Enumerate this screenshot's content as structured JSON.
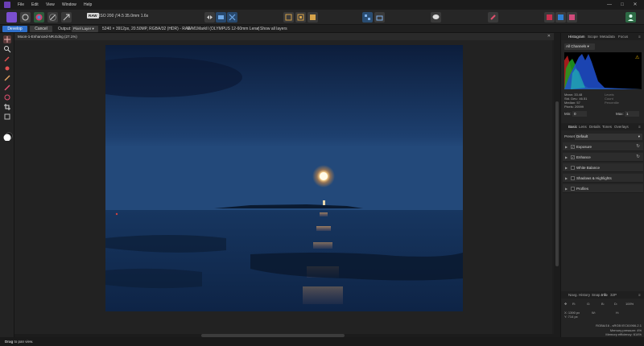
{
  "menu": {
    "items": [
      "File",
      "Edit",
      "View",
      "Window",
      "Help"
    ],
    "window_controls": [
      "—",
      "□",
      "✕"
    ]
  },
  "toolbar": {
    "raw_badge": "RAW",
    "exif": "ISO 200 ƒ/4.5 35.0mm 1.6s"
  },
  "context": {
    "develop_label": "Develop",
    "cancel_label": "Cancel",
    "output_label": "Output:",
    "output_value": "Pixel Layer",
    "image_info": "5240 × 3912px, 20.50MP, RGBA/32 (HDR) - RAW",
    "camera_info": "E-M1MarkII (OLYMPUS 12-60mm Lens)",
    "show_all_layers": "Show all layers"
  },
  "document": {
    "tab_title": "Moon-1-Enhanced-NR.Edng (27.1%)"
  },
  "histogram": {
    "tabs": [
      "Histogram",
      "Scope",
      "Metadata",
      "Focus"
    ],
    "channel": "All Channels",
    "mean": "Mean: 33.48",
    "std_dev": "Std. Dev.: 46.51",
    "median": "Median: 57",
    "pixels": "Pixels: 20599",
    "levels": "Levels",
    "count": "Count",
    "percentile": "Percentile",
    "min_label": "Min:",
    "min_value": "0",
    "max_label": "Max:",
    "max_value": "1",
    "warning_icon": "warning-triangle-icon"
  },
  "adjust": {
    "tabs": [
      "Basic",
      "Lens",
      "Details",
      "Tones",
      "Overlays"
    ],
    "preset_label": "Preset:",
    "preset_value": "Default",
    "sections": [
      {
        "name": "Exposure",
        "checked": true
      },
      {
        "name": "Enhance",
        "checked": true
      },
      {
        "name": "White Balance",
        "checked": false
      },
      {
        "name": "Shadows & Highlights",
        "checked": false
      },
      {
        "name": "Profiles",
        "checked": false
      }
    ]
  },
  "info": {
    "tabs": [
      "Navg.",
      "History",
      "Snap.",
      "Info",
      "32P"
    ],
    "x": "X: 1390 px",
    "y": "Y: 714 px",
    "r": "R:",
    "g": "G:",
    "b": "B:",
    "w": "W:",
    "h": "H:",
    "d": "D:",
    "zoom": "100%",
    "color_format": "RGBA/16 - sRGB IEC61966-2.1",
    "memory_pressure": "Memory pressure: 4%",
    "memory_efficiency": "Memory efficiency: 614%"
  },
  "status": {
    "hint_bold": "Drag",
    "hint_rest": " to pan view."
  },
  "colors": {
    "accent": "#2f6fc9",
    "app_icon": "#6b3fb6",
    "warning": "#e5b000"
  }
}
